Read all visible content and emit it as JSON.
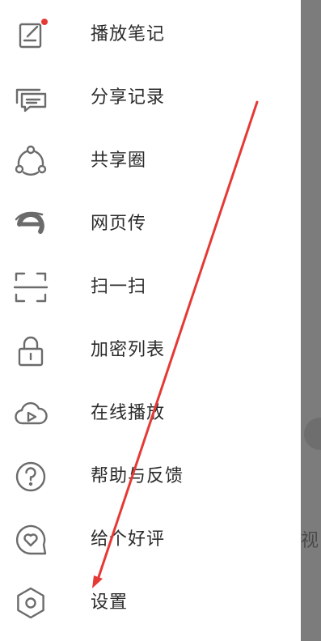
{
  "drawer": {
    "items": [
      {
        "label": "播放笔记",
        "icon": "note-icon",
        "badge_color": "#e53935"
      },
      {
        "label": "分享记录",
        "icon": "share-history-icon"
      },
      {
        "label": "共享圈",
        "icon": "share-circle-icon"
      },
      {
        "label": "网页传",
        "icon": "web-transfer-icon"
      },
      {
        "label": "扫一扫",
        "icon": "scan-icon"
      },
      {
        "label": "加密列表",
        "icon": "lock-icon"
      },
      {
        "label": "在线播放",
        "icon": "cloud-play-icon"
      },
      {
        "label": "帮助与反馈",
        "icon": "help-icon"
      },
      {
        "label": "给个好评",
        "icon": "heart-chat-icon"
      },
      {
        "label": "设置",
        "icon": "settings-icon"
      }
    ]
  },
  "backdrop": {
    "partial_text": "视"
  },
  "colors": {
    "icon_stroke": "#6b6b6b",
    "label_text": "#2b2b2b",
    "annotation_arrow": "#e53935",
    "backdrop": "#7c7c7c"
  }
}
